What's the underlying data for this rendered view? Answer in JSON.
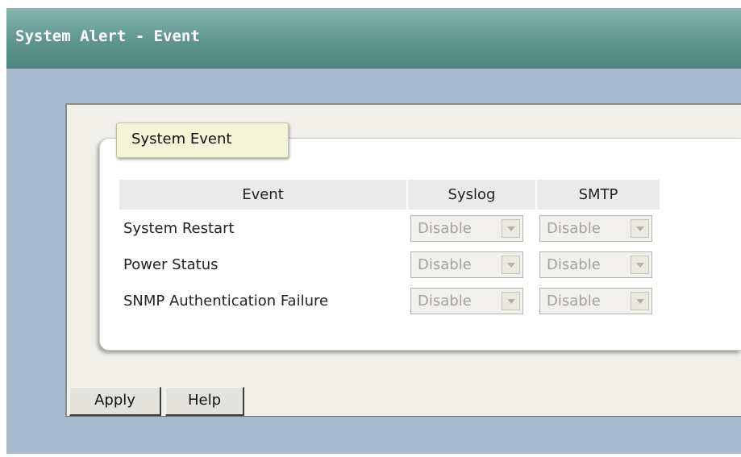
{
  "header": {
    "title": "System Alert - Event"
  },
  "group": {
    "label": "System Event"
  },
  "table": {
    "columns": [
      "Event",
      "Syslog",
      "SMTP"
    ],
    "rows": [
      {
        "event": "System Restart",
        "syslog": "Disable",
        "smtp": "Disable"
      },
      {
        "event": "Power Status",
        "syslog": "Disable",
        "smtp": "Disable"
      },
      {
        "event": "SNMP Authentication Failure",
        "syslog": "Disable",
        "smtp": "Disable"
      }
    ]
  },
  "buttons": {
    "apply": "Apply",
    "help": "Help"
  },
  "icons": {
    "dropdown_arrow": "chevron-down-icon"
  },
  "colors": {
    "title_bar": "#5f9690",
    "background": "#a6bacd",
    "panel": "#f0efea",
    "group_label_bg": "#f4f4d6",
    "disabled_text": "#a3a39b"
  }
}
